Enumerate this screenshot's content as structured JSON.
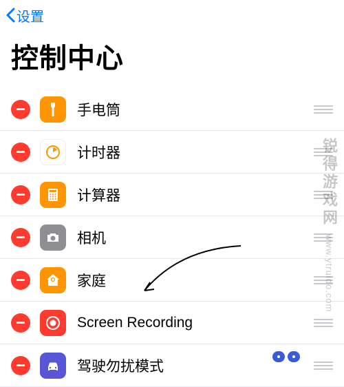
{
  "nav": {
    "back_label": "设置"
  },
  "title": "控制中心",
  "items": [
    {
      "id": "flashlight",
      "label": "手电筒",
      "icon": "flashlight-icon",
      "bg": "ic-orange"
    },
    {
      "id": "timer",
      "label": "计时器",
      "icon": "timer-icon",
      "bg": "ic-orange"
    },
    {
      "id": "calculator",
      "label": "计算器",
      "icon": "calculator-icon",
      "bg": "ic-orange"
    },
    {
      "id": "camera",
      "label": "相机",
      "icon": "camera-icon",
      "bg": "ic-gray"
    },
    {
      "id": "home",
      "label": "家庭",
      "icon": "home-icon",
      "bg": "ic-orange"
    },
    {
      "id": "screen-recording",
      "label": "Screen Recording",
      "icon": "screen-recording-icon",
      "bg": "ic-red"
    },
    {
      "id": "do-not-disturb-driving",
      "label": "驾驶勿扰模式",
      "icon": "car-icon",
      "bg": "ic-purple"
    }
  ],
  "watermark": {
    "brand": "锐得游戏网",
    "url": "www.ytruido.com"
  },
  "colors": {
    "accent": "#007aff",
    "remove": "#ff3b30",
    "orange": "#ff9500",
    "gray": "#8e8e93",
    "purple": "#5856d6"
  }
}
